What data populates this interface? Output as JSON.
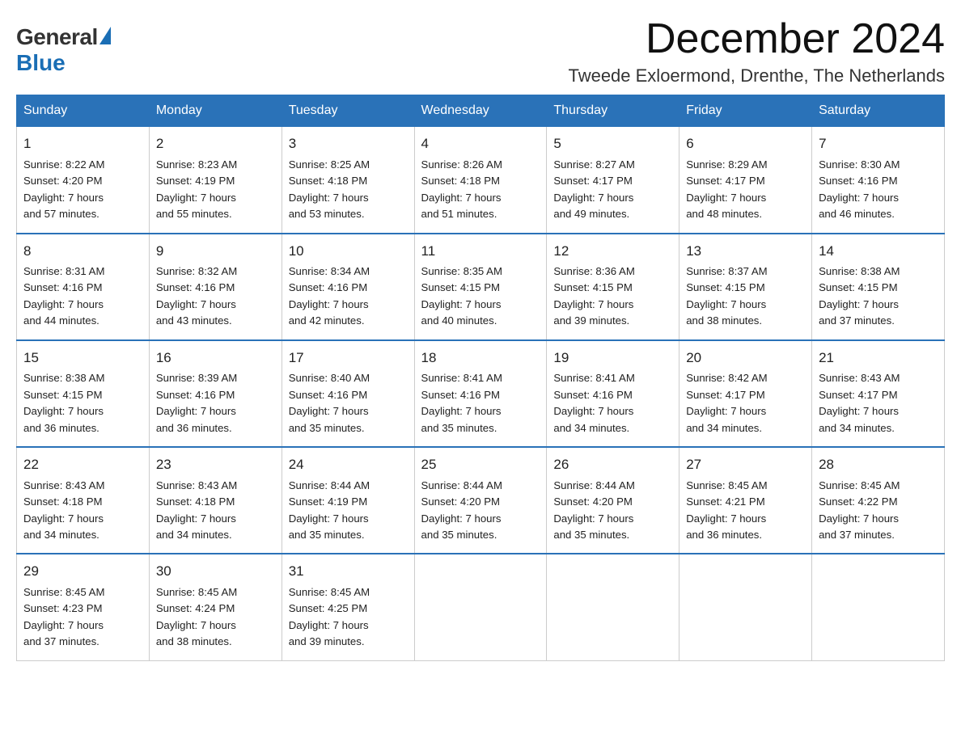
{
  "logo": {
    "general": "General",
    "blue": "Blue"
  },
  "title": {
    "month": "December 2024",
    "location": "Tweede Exloermond, Drenthe, The Netherlands"
  },
  "weekdays": [
    "Sunday",
    "Monday",
    "Tuesday",
    "Wednesday",
    "Thursday",
    "Friday",
    "Saturday"
  ],
  "weeks": [
    [
      {
        "day": "1",
        "sunrise": "8:22 AM",
        "sunset": "4:20 PM",
        "daylight": "7 hours and 57 minutes."
      },
      {
        "day": "2",
        "sunrise": "8:23 AM",
        "sunset": "4:19 PM",
        "daylight": "7 hours and 55 minutes."
      },
      {
        "day": "3",
        "sunrise": "8:25 AM",
        "sunset": "4:18 PM",
        "daylight": "7 hours and 53 minutes."
      },
      {
        "day": "4",
        "sunrise": "8:26 AM",
        "sunset": "4:18 PM",
        "daylight": "7 hours and 51 minutes."
      },
      {
        "day": "5",
        "sunrise": "8:27 AM",
        "sunset": "4:17 PM",
        "daylight": "7 hours and 49 minutes."
      },
      {
        "day": "6",
        "sunrise": "8:29 AM",
        "sunset": "4:17 PM",
        "daylight": "7 hours and 48 minutes."
      },
      {
        "day": "7",
        "sunrise": "8:30 AM",
        "sunset": "4:16 PM",
        "daylight": "7 hours and 46 minutes."
      }
    ],
    [
      {
        "day": "8",
        "sunrise": "8:31 AM",
        "sunset": "4:16 PM",
        "daylight": "7 hours and 44 minutes."
      },
      {
        "day": "9",
        "sunrise": "8:32 AM",
        "sunset": "4:16 PM",
        "daylight": "7 hours and 43 minutes."
      },
      {
        "day": "10",
        "sunrise": "8:34 AM",
        "sunset": "4:16 PM",
        "daylight": "7 hours and 42 minutes."
      },
      {
        "day": "11",
        "sunrise": "8:35 AM",
        "sunset": "4:15 PM",
        "daylight": "7 hours and 40 minutes."
      },
      {
        "day": "12",
        "sunrise": "8:36 AM",
        "sunset": "4:15 PM",
        "daylight": "7 hours and 39 minutes."
      },
      {
        "day": "13",
        "sunrise": "8:37 AM",
        "sunset": "4:15 PM",
        "daylight": "7 hours and 38 minutes."
      },
      {
        "day": "14",
        "sunrise": "8:38 AM",
        "sunset": "4:15 PM",
        "daylight": "7 hours and 37 minutes."
      }
    ],
    [
      {
        "day": "15",
        "sunrise": "8:38 AM",
        "sunset": "4:15 PM",
        "daylight": "7 hours and 36 minutes."
      },
      {
        "day": "16",
        "sunrise": "8:39 AM",
        "sunset": "4:16 PM",
        "daylight": "7 hours and 36 minutes."
      },
      {
        "day": "17",
        "sunrise": "8:40 AM",
        "sunset": "4:16 PM",
        "daylight": "7 hours and 35 minutes."
      },
      {
        "day": "18",
        "sunrise": "8:41 AM",
        "sunset": "4:16 PM",
        "daylight": "7 hours and 35 minutes."
      },
      {
        "day": "19",
        "sunrise": "8:41 AM",
        "sunset": "4:16 PM",
        "daylight": "7 hours and 34 minutes."
      },
      {
        "day": "20",
        "sunrise": "8:42 AM",
        "sunset": "4:17 PM",
        "daylight": "7 hours and 34 minutes."
      },
      {
        "day": "21",
        "sunrise": "8:43 AM",
        "sunset": "4:17 PM",
        "daylight": "7 hours and 34 minutes."
      }
    ],
    [
      {
        "day": "22",
        "sunrise": "8:43 AM",
        "sunset": "4:18 PM",
        "daylight": "7 hours and 34 minutes."
      },
      {
        "day": "23",
        "sunrise": "8:43 AM",
        "sunset": "4:18 PM",
        "daylight": "7 hours and 34 minutes."
      },
      {
        "day": "24",
        "sunrise": "8:44 AM",
        "sunset": "4:19 PM",
        "daylight": "7 hours and 35 minutes."
      },
      {
        "day": "25",
        "sunrise": "8:44 AM",
        "sunset": "4:20 PM",
        "daylight": "7 hours and 35 minutes."
      },
      {
        "day": "26",
        "sunrise": "8:44 AM",
        "sunset": "4:20 PM",
        "daylight": "7 hours and 35 minutes."
      },
      {
        "day": "27",
        "sunrise": "8:45 AM",
        "sunset": "4:21 PM",
        "daylight": "7 hours and 36 minutes."
      },
      {
        "day": "28",
        "sunrise": "8:45 AM",
        "sunset": "4:22 PM",
        "daylight": "7 hours and 37 minutes."
      }
    ],
    [
      {
        "day": "29",
        "sunrise": "8:45 AM",
        "sunset": "4:23 PM",
        "daylight": "7 hours and 37 minutes."
      },
      {
        "day": "30",
        "sunrise": "8:45 AM",
        "sunset": "4:24 PM",
        "daylight": "7 hours and 38 minutes."
      },
      {
        "day": "31",
        "sunrise": "8:45 AM",
        "sunset": "4:25 PM",
        "daylight": "7 hours and 39 minutes."
      },
      null,
      null,
      null,
      null
    ]
  ],
  "labels": {
    "sunrise": "Sunrise:",
    "sunset": "Sunset:",
    "daylight": "Daylight:"
  }
}
